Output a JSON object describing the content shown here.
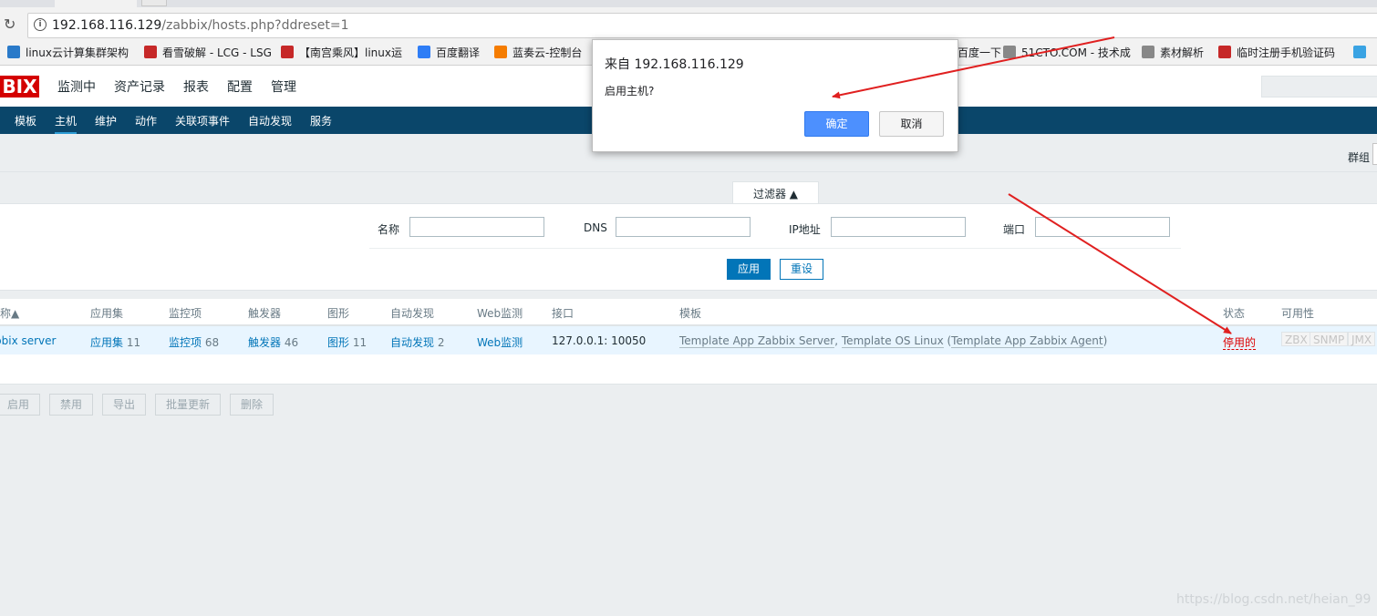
{
  "browser": {
    "address": {
      "host": "192.168.116.129",
      "path": "/zabbix/hosts.php?ddreset=1"
    },
    "bookmarks": [
      {
        "label": "linux云计算集群架构",
        "icon_color": "#2a7ac9"
      },
      {
        "label": "看雪破解 - LCG - LSG",
        "icon_color": "#c62828"
      },
      {
        "label": "【南宫乘风】linux运",
        "icon_color": "#c62828"
      },
      {
        "label": "百度翻译",
        "icon_color": "#2e7df6"
      },
      {
        "label": "蓝奏云-控制台",
        "icon_color": "#f57c00"
      },
      {
        "label": "百度一下",
        "icon_color": "#2e7df6"
      },
      {
        "label": "51CTO.COM - 技术成",
        "icon_color": "#888888"
      },
      {
        "label": "素材解析",
        "icon_color": "#888888"
      },
      {
        "label": "临时注册手机验证码",
        "icon_color": "#c62828"
      },
      {
        "label": "",
        "icon_color": "#3aa3e3"
      }
    ]
  },
  "zabbix": {
    "logo": "BIX",
    "top_menu": [
      "监测中",
      "资产记录",
      "报表",
      "配置",
      "管理"
    ],
    "active_top": "配置",
    "sub_menu": [
      "模板",
      "主机",
      "维护",
      "动作",
      "关联项事件",
      "自动发现",
      "服务"
    ],
    "active_sub": "主机",
    "group_label": "群组"
  },
  "filter": {
    "tab_label": "过滤器 ▲",
    "labels": {
      "name": "名称",
      "dns": "DNS",
      "ip": "IP地址",
      "port": "端口"
    },
    "values": {
      "name": "",
      "dns": "",
      "ip": "",
      "port": ""
    },
    "apply": "应用",
    "reset": "重设"
  },
  "table": {
    "headers": [
      "称▲",
      "应用集",
      "监控项",
      "触发器",
      "图形",
      "自动发现",
      "Web监测",
      "接口",
      "模板",
      "状态",
      "可用性"
    ],
    "row": {
      "name": "bbix server",
      "apps_label": "应用集",
      "apps_count": "11",
      "items_label": "监控项",
      "items_count": "68",
      "triggers_label": "触发器",
      "triggers_count": "46",
      "graphs_label": "图形",
      "graphs_count": "11",
      "discovery_label": "自动发现",
      "discovery_count": "2",
      "web": "Web监测",
      "interface": "127.0.0.1: 10050",
      "template1": "Template App Zabbix Server",
      "sep": ", ",
      "template2": "Template OS Linux",
      "paren_open": " (",
      "template3": "Template App Zabbix Agent",
      "paren_close": ")",
      "status": "停用的",
      "availability": [
        "ZBX",
        "SNMP",
        "JMX"
      ]
    }
  },
  "actions": [
    "启用",
    "禁用",
    "导出",
    "批量更新",
    "删除"
  ],
  "dialog": {
    "title": "来自 192.168.116.129",
    "message": "启用主机?",
    "ok": "确定",
    "cancel": "取消"
  },
  "watermark": "https://blog.csdn.net/heian_99",
  "colors": {
    "brand_red": "#d40000",
    "nav_blue": "#0a466a",
    "link": "#0275b8",
    "status_disabled": "#dc0000",
    "annotation_arrow": "#e02020"
  }
}
